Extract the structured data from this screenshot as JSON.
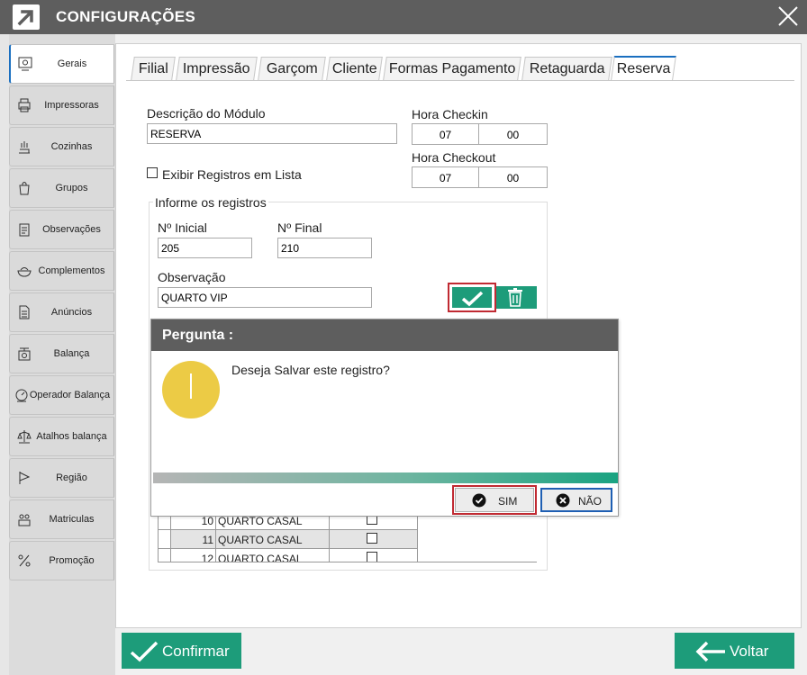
{
  "window": {
    "title": "CONFIGURAÇÕES"
  },
  "sidebar": {
    "items": [
      {
        "label": "Gerais",
        "icon": "settings-panel-icon",
        "active": true
      },
      {
        "label": "Impressoras",
        "icon": "printer-icon"
      },
      {
        "label": "Cozinhas",
        "icon": "kitchen-icon"
      },
      {
        "label": "Grupos",
        "icon": "shopping-bag-icon"
      },
      {
        "label": "Observações",
        "icon": "clipboard-icon"
      },
      {
        "label": "Complementos",
        "icon": "bowl-icon"
      },
      {
        "label": "Anúncios",
        "icon": "document-icon"
      },
      {
        "label": "Balança",
        "icon": "scale-icon"
      },
      {
        "label": "Operador  Balança",
        "icon": "scale-operator-icon"
      },
      {
        "label": "Atalhos balança",
        "icon": "scale-shortcut-icon"
      },
      {
        "label": "Região",
        "icon": "flag-icon"
      },
      {
        "label": "Matriculas",
        "icon": "enrollment-icon"
      },
      {
        "label": "Promoção",
        "icon": "promotion-icon"
      }
    ]
  },
  "tabs": [
    "Filial",
    "Impressão",
    "Garçom",
    "Cliente",
    "Formas Pagamento",
    "Retaguarda",
    "Reserva"
  ],
  "form": {
    "descricao_label": "Descrição do Módulo",
    "descricao_value": "RESERVA",
    "hora_checkin_label": "Hora Checkin",
    "checkin_hour": "07",
    "checkin_min": "00",
    "hora_checkout_label": "Hora Checkout",
    "checkout_hour": "07",
    "checkout_min": "00",
    "exibir_label": "Exibir Registros em Lista",
    "group_title": "Informe os registros",
    "n_inicial_label": "Nº Inicial",
    "n_inicial_value": "205",
    "n_final_label": "Nº Final",
    "n_final_value": "210",
    "observacao_label": "Observação",
    "observacao_value": "QUARTO VIP"
  },
  "table": {
    "rows": [
      {
        "num": "10",
        "desc": "QUARTO CASAL"
      },
      {
        "num": "11",
        "desc": "QUARTO CASAL"
      },
      {
        "num": "12",
        "desc": "QUARTO CASAL"
      }
    ]
  },
  "dialog": {
    "title": "Pergunta :",
    "message": "Deseja Salvar este registro?",
    "yes_label": "SIM",
    "no_label": "NÃO"
  },
  "footer": {
    "confirm_label": "Confirmar",
    "back_label": "Voltar"
  },
  "colors": {
    "accent_green": "#1d9c7a",
    "title_gray": "#5e5e5e",
    "highlight_red": "#c02a32",
    "focus_blue": "#1f5fb3",
    "warning_yellow": "#eccb45"
  }
}
